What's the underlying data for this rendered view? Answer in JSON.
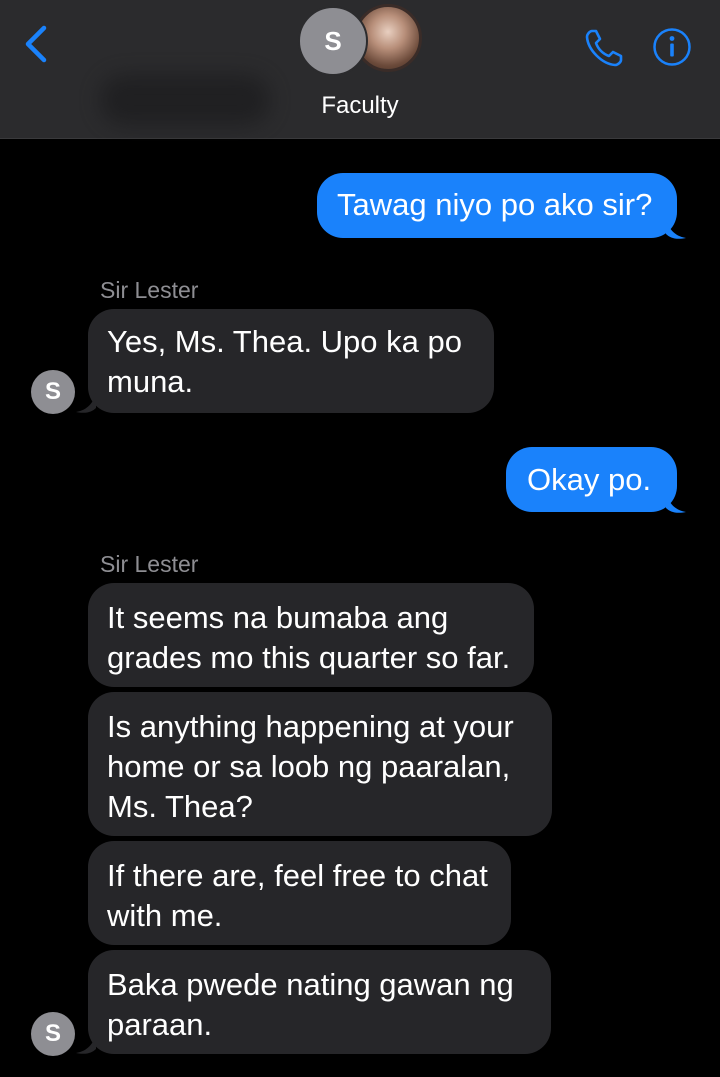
{
  "header": {
    "group_name": "Faculty",
    "avatar_initial": "S",
    "icons": {
      "back": "chevron-left-icon",
      "call": "phone-icon",
      "info": "info-icon"
    },
    "accent_color": "#1a82fb"
  },
  "conversation": {
    "messages": [
      {
        "direction": "outgoing",
        "lines": [
          "Tawag niyo po ako sir?"
        ]
      },
      {
        "direction": "incoming",
        "sender": "Sir Lester",
        "avatar_initial": "S",
        "lines": [
          "Yes, Ms. Thea. Upo ka po",
          "muna."
        ]
      },
      {
        "direction": "outgoing",
        "lines": [
          "Okay po."
        ]
      },
      {
        "direction": "incoming",
        "sender": "Sir Lester",
        "lines": [
          "It seems na bumaba ang",
          "grades mo this quarter so far."
        ]
      },
      {
        "direction": "incoming",
        "lines": [
          "Is anything happening at your",
          "home or sa loob ng paaralan,",
          "Ms. Thea?"
        ]
      },
      {
        "direction": "incoming",
        "lines": [
          "If there are, feel free to chat",
          "with me."
        ]
      },
      {
        "direction": "incoming",
        "avatar_initial": "S",
        "lines": [
          "Baka pwede nating gawan ng",
          "paraan."
        ]
      }
    ]
  }
}
